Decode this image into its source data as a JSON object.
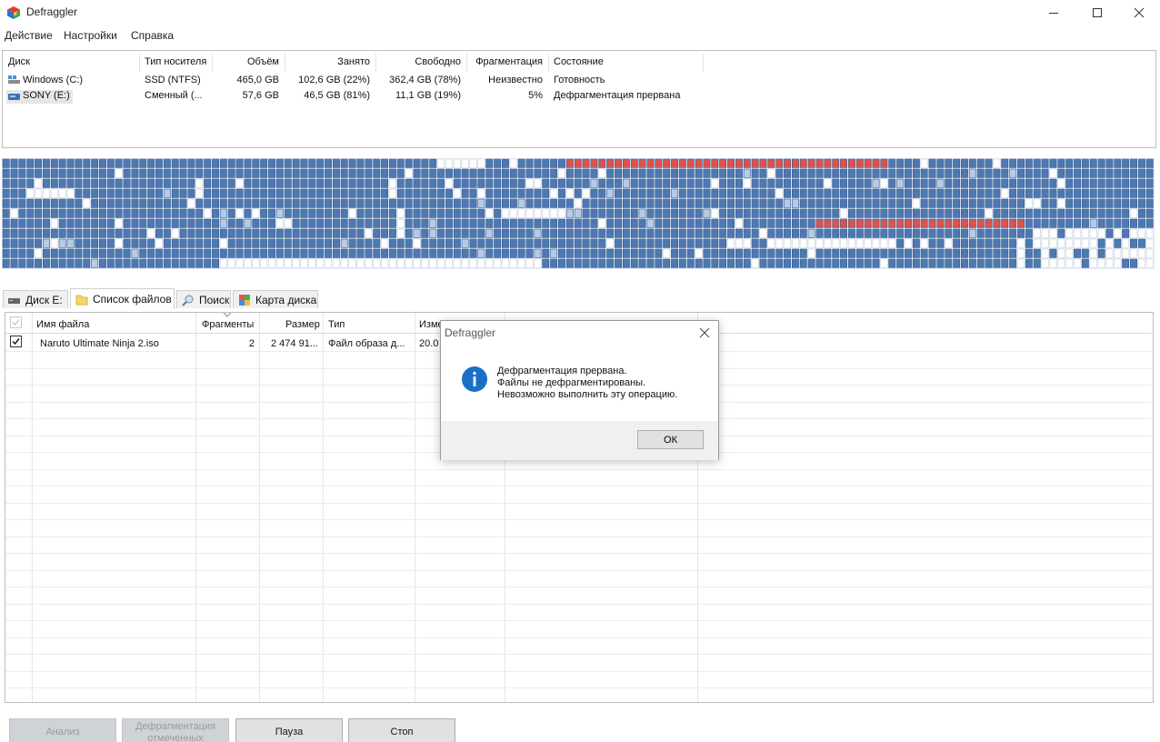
{
  "window": {
    "title": "Defraggler"
  },
  "menu": {
    "items": [
      "Действие",
      "Настройки",
      "Справка"
    ]
  },
  "drives": {
    "columns": [
      "Диск",
      "Тип носителя",
      "Объём",
      "Занято",
      "Свободно",
      "Фрагментация",
      "Состояние"
    ],
    "rows": [
      {
        "name": "Windows (C:)",
        "type": "SSD (NTFS)",
        "capacity": "465,0 GB",
        "used": "102,6 GB (22%)",
        "free": "362,4 GB (78%)",
        "fragmentation": "Неизвестно",
        "status": "Готовность"
      },
      {
        "name": "SONY (E:)",
        "type": "Сменный (...",
        "capacity": "57,6 GB",
        "used": "46,5 GB (81%)",
        "free": "11,1 GB (19%)",
        "fragmentation": "5%",
        "status": "Дефрагментация прервана"
      }
    ]
  },
  "diskmap": {
    "colors": {
      "used": "#4f78b0",
      "free": "#ffffff",
      "fragmented": "#d9534f",
      "selected": "#b8cbe6"
    }
  },
  "tabs": [
    {
      "label": "Диск E:",
      "icon": "drive-icon"
    },
    {
      "label": "Список файлов",
      "icon": "folder-icon"
    },
    {
      "label": "Поиск",
      "icon": "search-icon"
    },
    {
      "label": "Карта диска",
      "icon": "diskmap-icon"
    }
  ],
  "filelist": {
    "columns": [
      "Имя файла",
      "Фрагменты",
      "Размер",
      "Тип",
      "Изме"
    ],
    "rows": [
      {
        "checked": true,
        "name": "Naruto Ultimate Ninja 2.iso",
        "fragments": "2",
        "size": "2 474 91...",
        "type": "Файл образа д...",
        "modified": "20.0"
      }
    ]
  },
  "buttons": {
    "analyze": "Анализ",
    "defrag_checked": "Дефрагментация отмеченных",
    "pause": "Пауза",
    "stop": "Стоп"
  },
  "dialog": {
    "title": "Defraggler",
    "lines": [
      "Дефрагментация прервана.",
      "Файлы не дефрагментированы.",
      "Невозможно выполнить эту операцию."
    ],
    "ok": "ОК"
  }
}
